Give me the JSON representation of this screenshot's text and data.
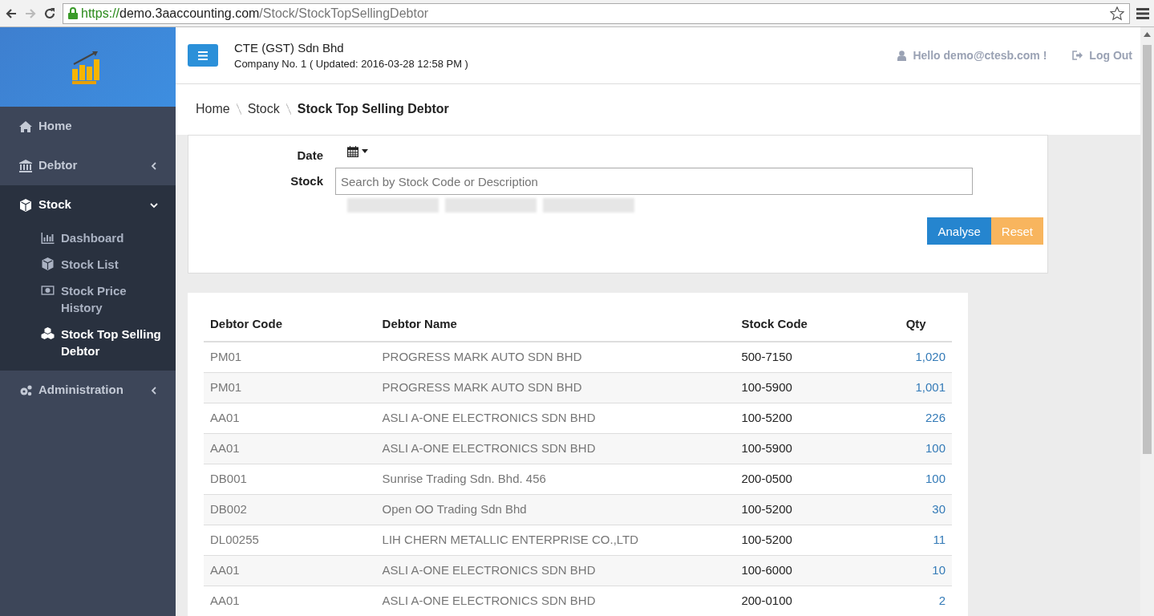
{
  "browser": {
    "nav": [
      {
        "kind": "back",
        "disabled": false
      },
      {
        "kind": "forward",
        "disabled": true
      },
      {
        "kind": "reload",
        "disabled": false
      }
    ],
    "url_scheme": "https://",
    "url_host": "demo.3aaccounting.com",
    "url_path": "/Stock/StockTopSellingDebtor"
  },
  "header": {
    "company": "CTE (GST) Sdn Bhd",
    "company_info": "Company No. 1 ( Updated: 2016-03-28 12:58 PM )",
    "greeting": "Hello demo@ctesb.com !",
    "logout": "Log Out"
  },
  "sidebar": {
    "items": [
      {
        "label": "Home"
      },
      {
        "label": "Debtor",
        "expanded": false
      },
      {
        "label": "Stock",
        "expanded": true,
        "children": [
          {
            "label": "Dashboard",
            "selected": false
          },
          {
            "label": "Stock List",
            "selected": false
          },
          {
            "label": "Stock Price History",
            "selected": false
          },
          {
            "label": "Stock Top Selling Debtor",
            "selected": true
          }
        ]
      },
      {
        "label": "Administration",
        "expanded": false
      }
    ]
  },
  "breadcrumb": [
    "Home",
    "Stock",
    "Stock Top Selling Debtor"
  ],
  "filter": {
    "date_label": "Date",
    "stock_label": "Stock",
    "stock_placeholder": "Search by Stock Code or Description",
    "buttons": [
      {
        "label": "Analyse",
        "kind": "primary"
      },
      {
        "label": "Reset",
        "kind": "warning"
      }
    ]
  },
  "table": {
    "columns": [
      "Debtor Code",
      "Debtor Name",
      "Stock Code",
      "Qty"
    ],
    "rows": [
      [
        "PM01",
        "PROGRESS MARK AUTO SDN BHD",
        "500-7150",
        "1,020"
      ],
      [
        "PM01",
        "PROGRESS MARK AUTO SDN BHD",
        "100-5900",
        "1,001"
      ],
      [
        "AA01",
        "ASLI A-ONE ELECTRONICS SDN BHD",
        "100-5200",
        "226"
      ],
      [
        "AA01",
        "ASLI A-ONE ELECTRONICS SDN BHD",
        "100-5900",
        "100"
      ],
      [
        "DB001",
        "Sunrise Trading Sdn. Bhd. 456",
        "200-0500",
        "100"
      ],
      [
        "DB002",
        "Open OO Trading Sdn Bhd",
        "100-5200",
        "30"
      ],
      [
        "DL00255",
        "LIH CHERN METALLIC ENTERPRISE CO.,LTD",
        "100-5200",
        "11"
      ],
      [
        "AA01",
        "ASLI A-ONE ELECTRONICS SDN BHD",
        "100-6000",
        "10"
      ],
      [
        "AA01",
        "ASLI A-ONE ELECTRONICS SDN BHD",
        "200-0100",
        "2"
      ]
    ]
  }
}
